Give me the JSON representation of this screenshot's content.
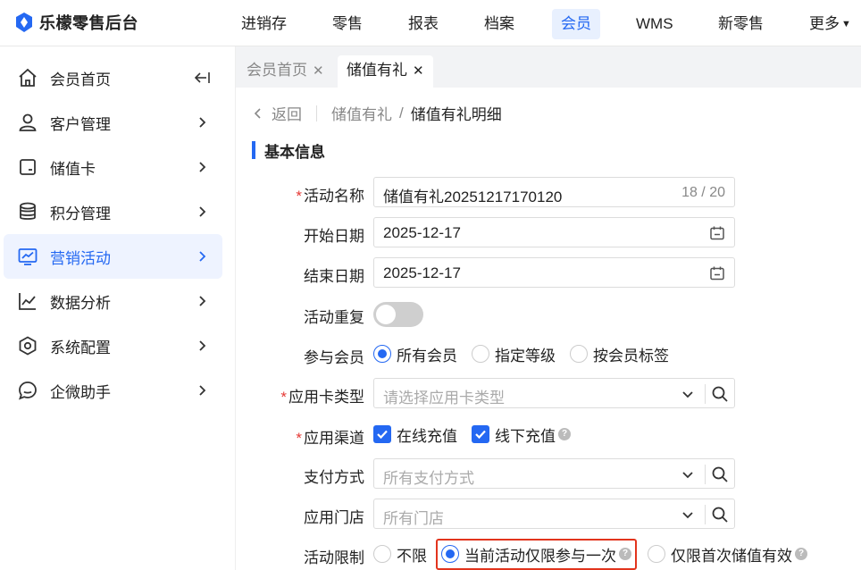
{
  "app": {
    "name": "乐檬零售后台",
    "brand_color": "#2468f2"
  },
  "topnav": {
    "items": [
      "进销存",
      "零售",
      "报表",
      "档案",
      "会员",
      "WMS",
      "新零售",
      "更多"
    ],
    "active_index": 4
  },
  "sidebar": {
    "items": [
      {
        "label": "会员首页",
        "icon": "home-icon"
      },
      {
        "label": "客户管理",
        "icon": "user-icon"
      },
      {
        "label": "储值卡",
        "icon": "card-icon"
      },
      {
        "label": "积分管理",
        "icon": "database-icon"
      },
      {
        "label": "营销活动",
        "icon": "marketing-icon"
      },
      {
        "label": "数据分析",
        "icon": "chart-icon"
      },
      {
        "label": "系统配置",
        "icon": "settings-icon"
      },
      {
        "label": "企微助手",
        "icon": "chat-icon"
      }
    ],
    "active_index": 4
  },
  "tabs": [
    {
      "label": "会员首页",
      "active": false
    },
    {
      "label": "储值有礼",
      "active": true
    }
  ],
  "breadcrumb": {
    "back": "返回",
    "parent": "储值有礼",
    "current": "储值有礼明细"
  },
  "section": {
    "title": "基本信息"
  },
  "form": {
    "activity_name": {
      "label": "活动名称",
      "required": true,
      "value": "储值有礼20251217170120",
      "count": "18 / 20"
    },
    "start_date": {
      "label": "开始日期",
      "value": "2025-12-17"
    },
    "end_date": {
      "label": "结束日期",
      "value": "2025-12-17"
    },
    "repeat": {
      "label": "活动重复",
      "on": false
    },
    "members": {
      "label": "参与会员",
      "options": [
        "所有会员",
        "指定等级",
        "按会员标签"
      ],
      "selected": 0
    },
    "card_type": {
      "label": "应用卡类型",
      "required": true,
      "placeholder": "请选择应用卡类型"
    },
    "channel": {
      "label": "应用渠道",
      "required": true,
      "options": [
        "在线充值",
        "线下充值"
      ]
    },
    "payment": {
      "label": "支付方式",
      "placeholder": "所有支付方式"
    },
    "store": {
      "label": "应用门店",
      "placeholder": "所有门店"
    },
    "limit": {
      "label": "活动限制",
      "options": [
        "不限",
        "当前活动仅限参与一次",
        "仅限首次储值有效"
      ],
      "selected": 1
    }
  },
  "help_glyph": "?"
}
